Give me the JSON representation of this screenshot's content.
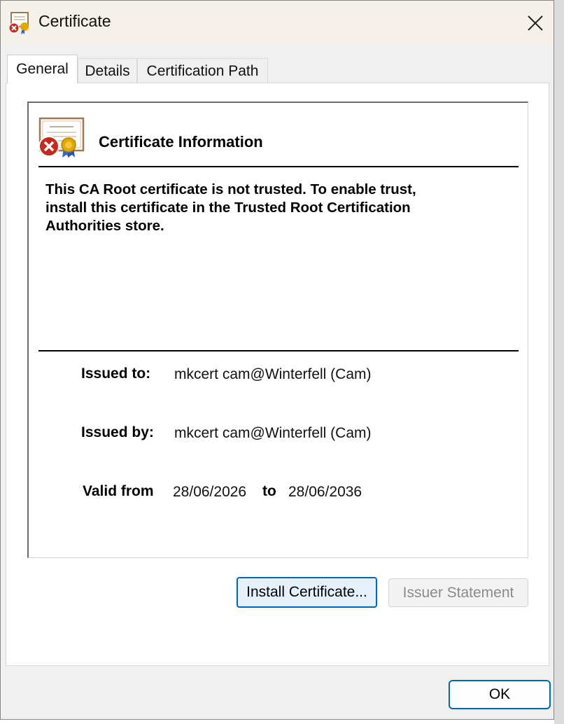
{
  "window": {
    "title": "Certificate"
  },
  "tabs": [
    {
      "label": "General",
      "active": true
    },
    {
      "label": "Details",
      "active": false
    },
    {
      "label": "Certification Path",
      "active": false
    }
  ],
  "general": {
    "heading": "Certificate Information",
    "warning_line1": "This CA Root certificate is not trusted. To enable trust,",
    "warning_line2": "install this certificate in the Trusted Root Certification",
    "warning_line3": "Authorities store.",
    "issued_to_label": "Issued to:",
    "issued_to_value": "mkcert cam@Winterfell (Cam)",
    "issued_by_label": "Issued by:",
    "issued_by_value": "mkcert cam@Winterfell (Cam)",
    "valid_from_label": "Valid from",
    "valid_from_value": "28/06/2026",
    "valid_to_label": "to",
    "valid_to_value": "28/06/2036"
  },
  "buttons": {
    "install": "Install Certificate...",
    "issuer_statement": "Issuer Statement",
    "ok": "OK"
  },
  "colors": {
    "accent": "#0067c0",
    "error": "#c42b1c",
    "seal": "#e0a800"
  },
  "icons": {
    "title": "certificate-error-icon",
    "info": "certificate-error-icon",
    "close": "close-icon"
  }
}
